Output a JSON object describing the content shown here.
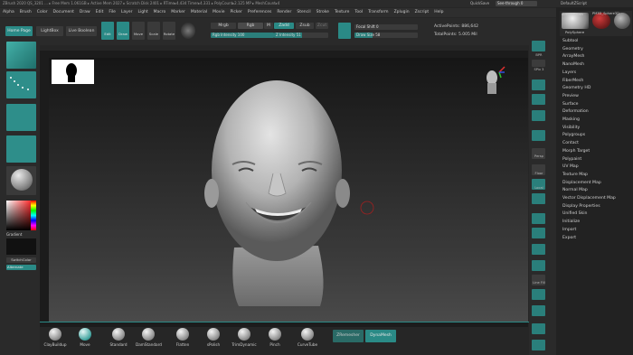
{
  "titlebar": {
    "text": "ZBrush 2020    QS_3201 ...  ▸ Free Mem 1.061GB  ▸ Active Mem 2027  ▸ Scratch Disk 2401  ▸ RTime▸4.434 Timer▸4.331  ▸ PolyCount▸2.125 MP  ▸ MeshCount▸4",
    "quicksave": "QuickSave",
    "seethrough": "See-through  0",
    "default_script": "DefaultZScript"
  },
  "menu": [
    "Alpha",
    "Brush",
    "Color",
    "Document",
    "Draw",
    "Edit",
    "File",
    "Layer",
    "Light",
    "Macro",
    "Marker",
    "Material",
    "Movie",
    "Picker",
    "Preferences",
    "Render",
    "Stencil",
    "Stroke",
    "Texture",
    "Tool",
    "Transform",
    "Zplugin",
    "Zscript",
    "Help"
  ],
  "shelf": {
    "home_page": "Home Page",
    "lightbox": "LightBox",
    "live_boolean": "Live Boolean",
    "edit": "Edit",
    "draw": "Draw",
    "move": "Move",
    "scale": "Scale",
    "rotate": "Rotate",
    "mrgb": "Mrgb",
    "rgb": "Rgb",
    "m": "M",
    "zadd": "Zadd",
    "zsub": "Zsub",
    "zcut": "Zcut",
    "rgb_intensity": "Rgb Intensity 100",
    "z_intensity": "Z Intensity 51",
    "focal_shift": "Focal Shift 0",
    "draw_size": "Draw Size 58",
    "active_points": "ActivePoints: 886,642",
    "total_points": "TotalPoints: 5.005 Mil"
  },
  "left": {
    "gradient": "Gradient",
    "switch_color": "SwitchColor",
    "alternate": "Alternate"
  },
  "bottom": {
    "brushes": [
      "ClayBuildup",
      "Move",
      "Standard",
      "DamStandard",
      "Flatten",
      "sPolish",
      "TrimDynamic",
      "Pinch",
      "CurveTube"
    ],
    "zremesher": "ZRemesher",
    "dynamesh": "DynaMesh"
  },
  "right_shelf": {
    "bpr": "BPR",
    "spix": "SPix 3",
    "persp": "Persp",
    "floor": "Floor",
    "local": "Local",
    "frame": "Frame",
    "move": "Move",
    "zoom3d": "Zoom3D",
    "rotate": "Rotate",
    "line_fill": "Line Fill",
    "polyf": "PolyF",
    "transp": "Transp",
    "dynamic": "Dynamic",
    "solo": "Solo",
    "xpose": "Xpose"
  },
  "tray": {
    "simple_brush": "SimpleBrush",
    "pm3d": "PM3D_Sphere3D",
    "polysphere": "PolySphere",
    "items": [
      "Subtool",
      "Geometry",
      "ArrayMesh",
      "NanoMesh",
      "Layers",
      "FiberMesh",
      "Geometry HD",
      "Preview",
      "Surface",
      "Deformation",
      "Masking",
      "Visibility",
      "Polygroups",
      "Contact",
      "Morph Target",
      "Polypaint",
      "UV Map",
      "Texture Map",
      "Displacement Map",
      "Normal Map",
      "Vector Displacement Map",
      "Display Properties",
      "Unified Skin",
      "Initialize",
      "Import",
      "Export"
    ]
  },
  "colors": {
    "accent": "#2a8a86",
    "background": "#262626"
  }
}
